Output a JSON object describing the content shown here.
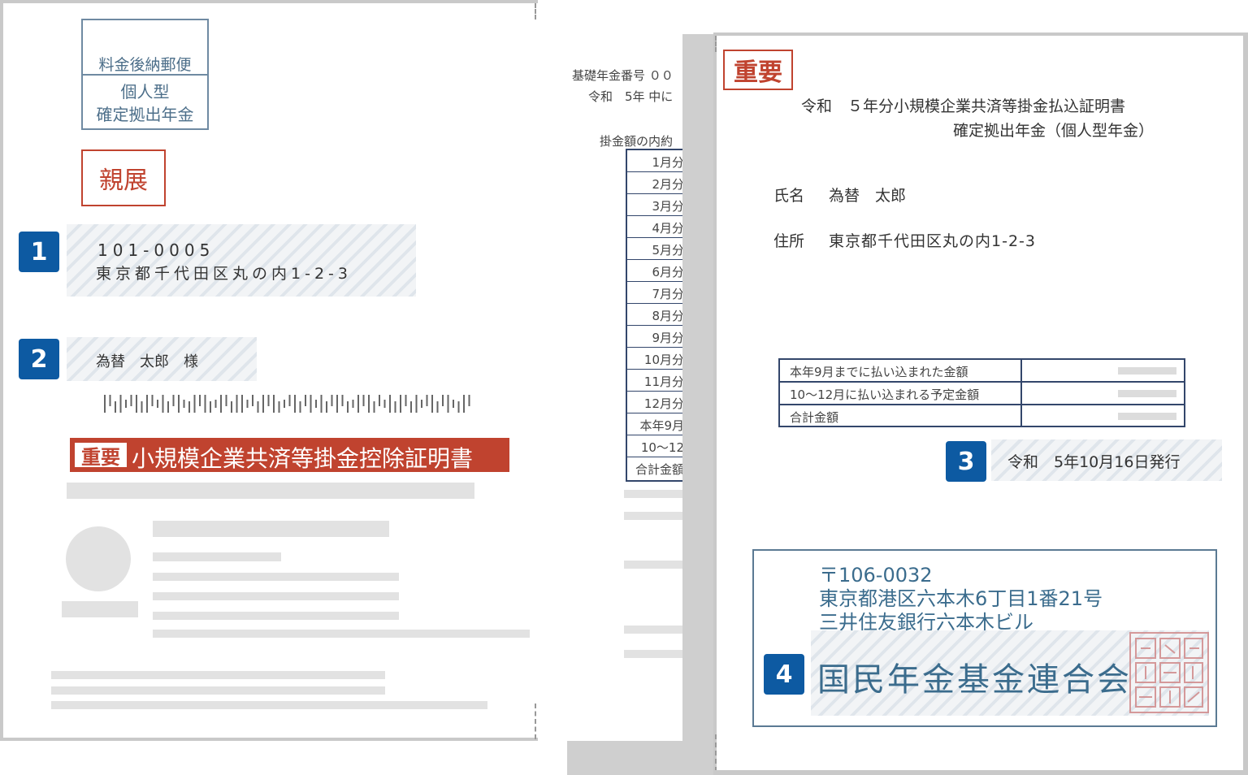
{
  "envelope": {
    "postage_line1": "料金後納郵便",
    "postage_line2": "個人型",
    "postage_line3": "確定拠出年金",
    "confidential": "親展",
    "address_badge": "1",
    "postal_code": "101-0005",
    "address": "東京都千代田区丸の内1-2-3",
    "name_badge": "2",
    "recipient": "為替　太郎　様",
    "title_tag": "重要",
    "title": "小規模企業共済等掛金控除証明書"
  },
  "middle_doc": {
    "pension_number": "基礎年金番号 ００",
    "period": "令和　5年 中に",
    "breakdown_label": "掛金額の内約",
    "months": [
      "1月分",
      "2月分",
      "3月分",
      "4月分",
      "5月分",
      "6月分",
      "7月分",
      "8月分",
      "9月分",
      "10月分",
      "11月分",
      "12月分",
      "本年9月",
      "10～12",
      "合計金額"
    ]
  },
  "certificate": {
    "important": "重要",
    "title_line1": "令和　５年分小規模企業共済等掛金払込証明書",
    "title_line2": "確定拠出年金（個人型年金）",
    "name_label": "氏名",
    "name_value": "為替　太郎",
    "address_label": "住所",
    "address_value": "東京都千代田区丸の内1-2-3",
    "table_rows": [
      "本年9月までに払い込まれた金額",
      "10～12月に払い込まれる予定金額",
      "合計金額"
    ],
    "date_badge": "3",
    "issue_date": "令和　5年10月16日発行",
    "issuer_postal": "〒106-0032",
    "issuer_address1": "東京都港区六本木6丁目1番21号",
    "issuer_address2": "三井住友銀行六本木ビル",
    "issuer_badge": "4",
    "issuer_name": "国民年金基金連合会",
    "seal_text": "国民年金基金連合会印"
  },
  "colors": {
    "red": "#c0432f",
    "badge_blue": "#0d5aa2",
    "slate": "#3b6c8d",
    "navy_border": "#33466b"
  }
}
